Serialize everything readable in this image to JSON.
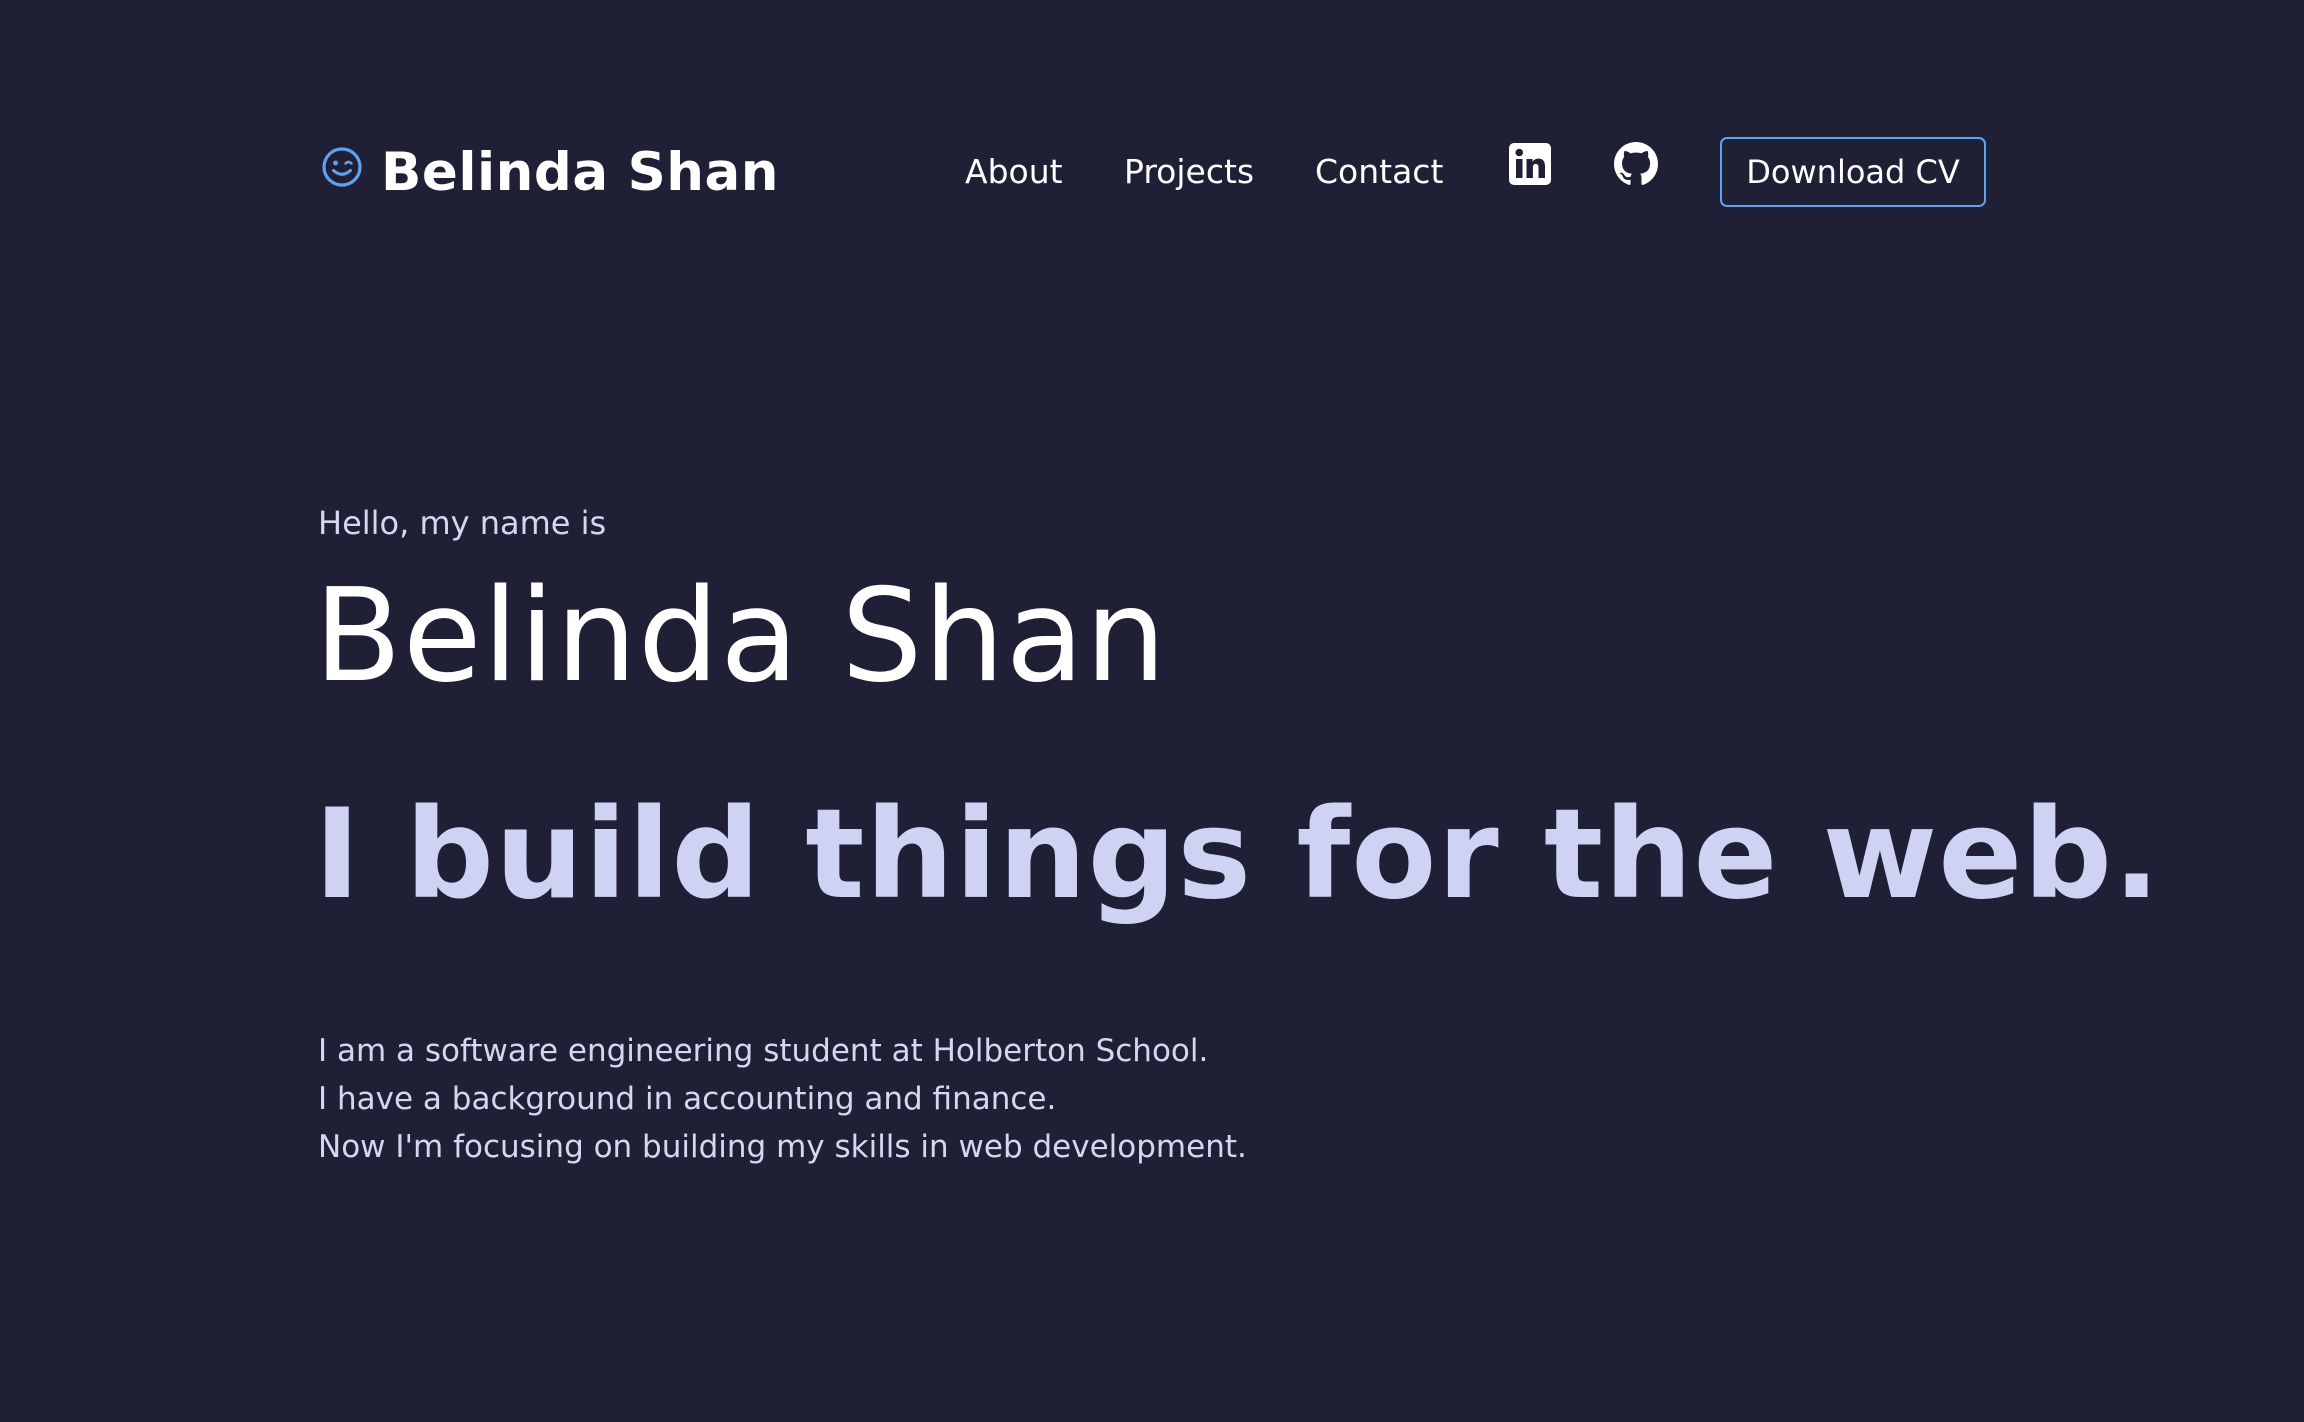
{
  "header": {
    "brand": {
      "icon": "wink-face-icon",
      "name": "Belinda Shan"
    },
    "nav": {
      "about": "About",
      "projects": "Projects",
      "contact": "Contact"
    },
    "social": {
      "linkedin_icon": "linkedin-icon",
      "github_icon": "github-icon"
    },
    "cv_button_label": "Download CV"
  },
  "hero": {
    "greeting": "Hello, my name is",
    "name": "Belinda Shan",
    "tagline": "I build things for the web.",
    "bio": [
      "I am a software engineering student at Holberton School.",
      "I have a background in accounting and finance.",
      "Now I'm focusing on building my skills in web development."
    ]
  },
  "colors": {
    "background": "#1f2035",
    "text_primary": "#ffffff",
    "text_secondary": "#d4d7f2",
    "tagline": "#cfd3f3",
    "accent": "#5fa3f0"
  }
}
